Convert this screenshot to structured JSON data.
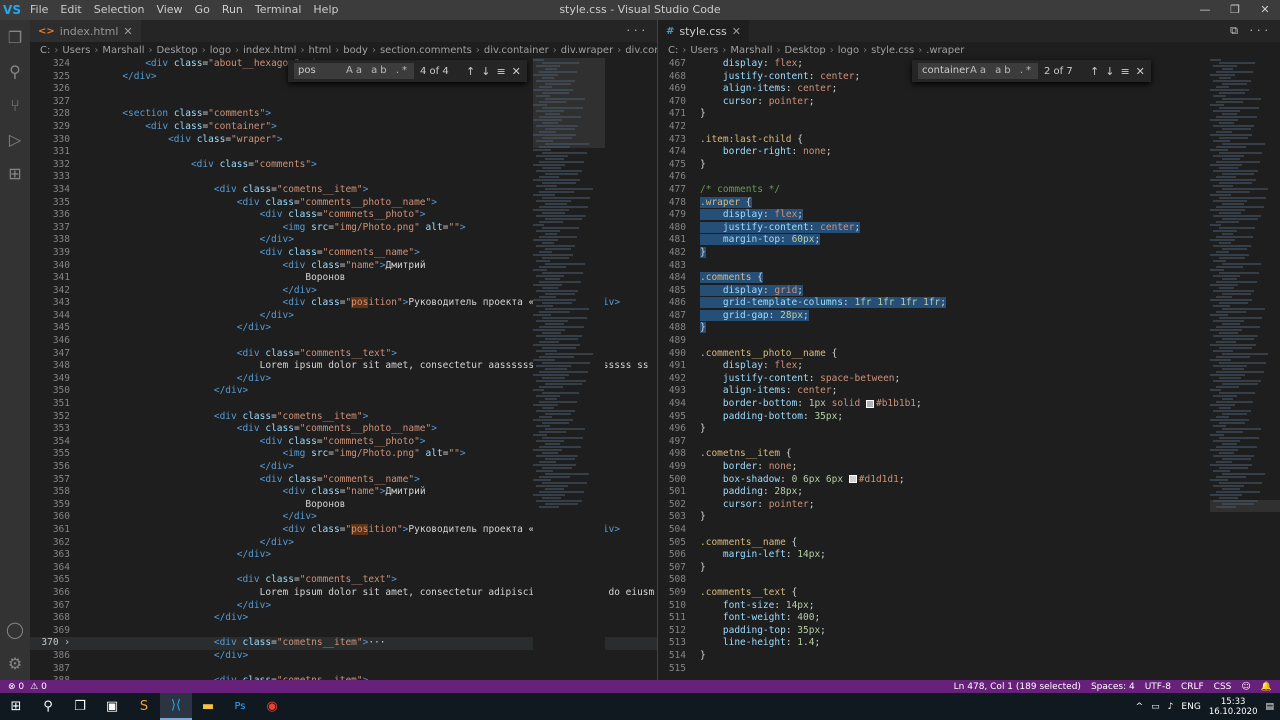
{
  "app": {
    "logo": "VS",
    "title": "style.css - Visual Studio Code",
    "menu": [
      "File",
      "Edit",
      "Selection",
      "View",
      "Go",
      "Run",
      "Terminal",
      "Help"
    ],
    "window_controls": [
      "—",
      "❐",
      "✕"
    ]
  },
  "activity_icons": [
    "files-icon",
    "search-icon",
    "source-control-icon",
    "run-debug-icon",
    "extensions-icon"
  ],
  "activity_bottom_icons": [
    "account-icon",
    "settings-gear-icon"
  ],
  "left_editor": {
    "tab": {
      "label": "index.html",
      "icon": "<>",
      "close": "✕"
    },
    "tab_actions": "···",
    "breadcrumb": [
      "C:",
      "Users",
      "Marshall",
      "Desktop",
      "logo",
      "index.html",
      "html",
      "body",
      "section.comments",
      "div.container",
      "div.wraper",
      "div.comment"
    ],
    "find": {
      "query": "pos",
      "options": "Aa ab .*",
      "count": "4 of 4",
      "prev": "↑",
      "next": "↓",
      "menu": "≡",
      "close": "✕"
    }
  },
  "right_editor": {
    "tab": {
      "label": "style.css",
      "icon": "#",
      "close": "✕"
    },
    "tab_actions": "⧉  ···",
    "breadcrumb": [
      "C:",
      "Users",
      "Marshall",
      "Desktop",
      "logo",
      "style.css",
      ".wraper"
    ],
    "find": {
      "query": "container",
      "options": "Aa ab .*",
      "count": "2 of 7",
      "prev": "↑",
      "next": "↓",
      "menu": "≡",
      "close": "✕"
    }
  },
  "status": {
    "errors": "⊗ 0",
    "warnings": "⚠ 0",
    "position": "Ln 478, Col 1 (189 selected)",
    "spaces": "Spaces: 4",
    "encoding": "UTF-8",
    "eol": "CRLF",
    "language": "CSS",
    "feedback": "☺",
    "notifications": "🔔"
  },
  "taskbar": {
    "icons": [
      "windows-start-icon",
      "search-icon",
      "task-view-icon",
      "store-icon",
      "sublime-icon",
      "vscode-icon",
      "file-explorer-icon",
      "photoshop-icon",
      "chrome-icon"
    ],
    "glyphs": [
      "⊞",
      "⚲",
      "❐",
      "▣",
      "S",
      "⟩⟨",
      "▬",
      "Ps",
      "◉"
    ],
    "tray_lang": "ENG",
    "time": "15:33",
    "date": "16.10.2020"
  }
}
